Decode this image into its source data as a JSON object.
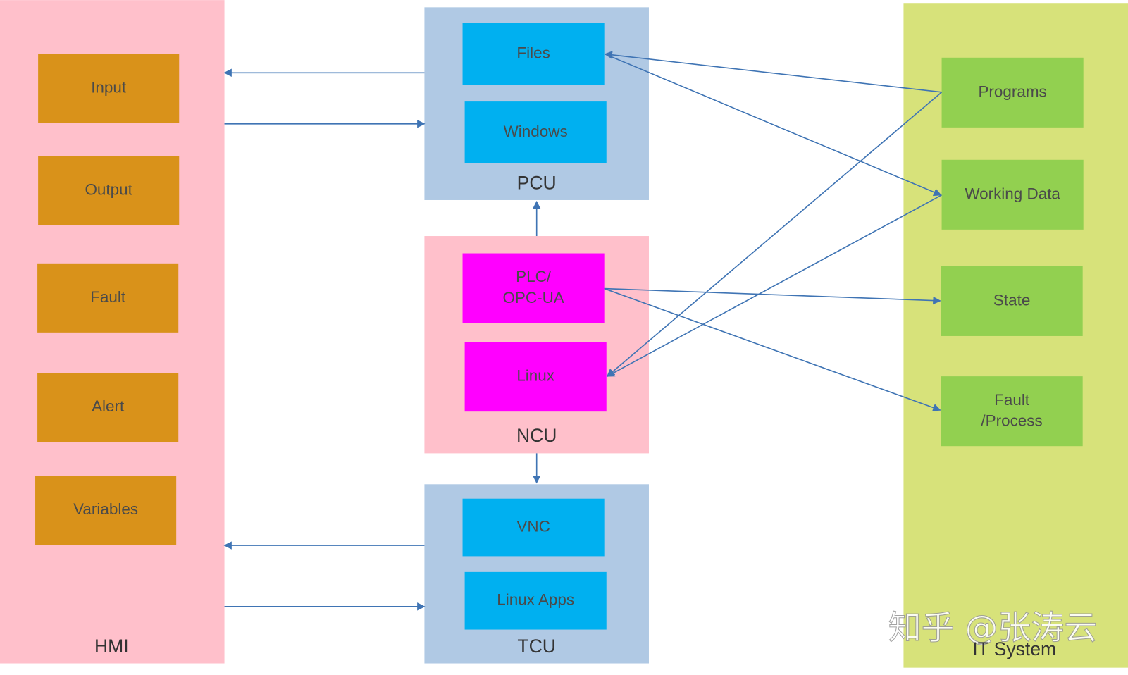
{
  "colors": {
    "hmi_panel": "#FFC0CB",
    "hmi_item": "#D9921A",
    "pcu_tcu_panel": "#B0C9E4",
    "pcu_tcu_item": "#00B0F0",
    "ncu_panel": "#FFC0CB",
    "ncu_item": "#FF00FF",
    "it_panel": "#D7E27A",
    "it_item": "#92D050",
    "connector": "#3F74B4",
    "text": "#4A4A4A"
  },
  "hmi": {
    "label": "HMI",
    "items": [
      "Input",
      "Output",
      "Fault",
      "Alert",
      "Variables"
    ]
  },
  "pcu": {
    "label": "PCU",
    "items": [
      "Files",
      "Windows"
    ]
  },
  "ncu": {
    "label": "NCU",
    "items": [
      [
        "PLC/",
        "OPC-UA"
      ],
      [
        "Linux"
      ]
    ]
  },
  "tcu": {
    "label": "TCU",
    "items": [
      "VNC",
      "Linux Apps"
    ]
  },
  "it_system": {
    "label": "IT System",
    "items": [
      [
        "Programs"
      ],
      [
        "Working Data"
      ],
      [
        "State"
      ],
      [
        "Fault",
        "/Process"
      ]
    ]
  },
  "connections": [
    {
      "from": "PCU",
      "to": "HMI"
    },
    {
      "from": "HMI",
      "to": "PCU"
    },
    {
      "from": "NCU",
      "to": "PCU"
    },
    {
      "from": "NCU",
      "to": "TCU"
    },
    {
      "from": "TCU",
      "to": "HMI"
    },
    {
      "from": "HMI",
      "to": "TCU"
    },
    {
      "from": "Programs",
      "to": "Files"
    },
    {
      "from": "Files",
      "to": "Working Data"
    },
    {
      "from": "Programs",
      "to": "Linux"
    },
    {
      "from": "Working Data",
      "to": "Linux"
    },
    {
      "from": "PLC/OPC-UA",
      "to": "State"
    },
    {
      "from": "PLC/OPC-UA",
      "to": "Fault/Process"
    }
  ],
  "watermark": "知乎 @张涛云"
}
